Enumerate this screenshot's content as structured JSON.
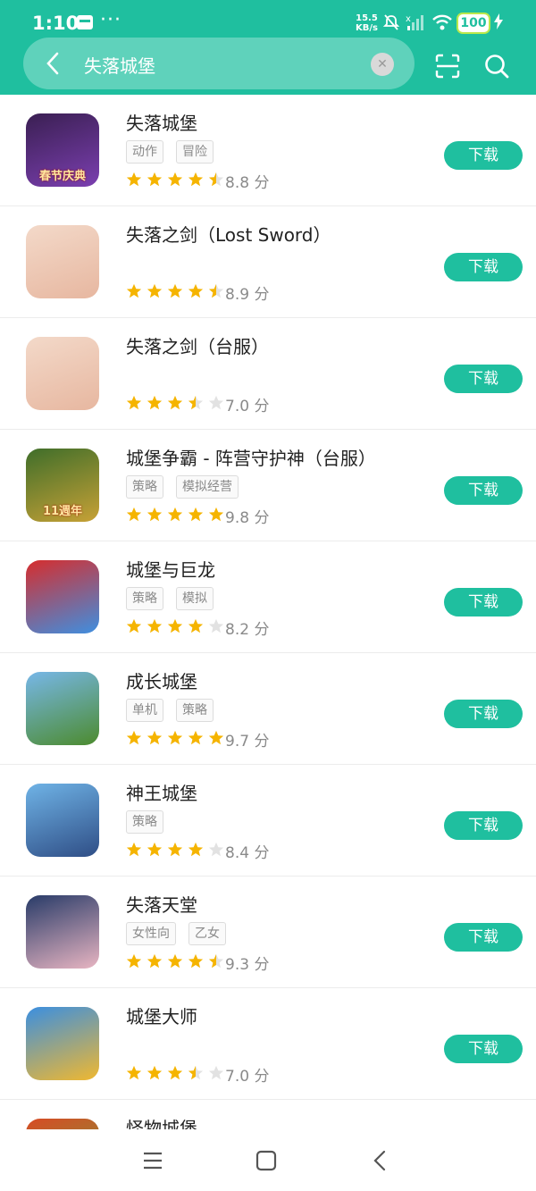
{
  "status": {
    "time": "1:10",
    "dots": "···",
    "net_speed_value": "15.5",
    "net_speed_unit": "KB/s",
    "battery": "100"
  },
  "search": {
    "query": "失落城堡"
  },
  "download_label": "下载",
  "apps": [
    {
      "name": "失落城堡",
      "tags": [
        "动作",
        "冒险"
      ],
      "rating": 4.5,
      "score": "8.8 分",
      "icon": "app-icon-lost-castle",
      "icon_text": "春节庆典",
      "colors": [
        "#3a1f52",
        "#7b3fb0"
      ]
    },
    {
      "name": "失落之剑（Lost Sword）",
      "tags": [],
      "rating": 4.5,
      "score": "8.9 分",
      "icon": "app-icon-lost-sword",
      "icon_text": "",
      "colors": [
        "#f3d9c9",
        "#e7b7a0"
      ]
    },
    {
      "name": "失落之剑（台服）",
      "tags": [],
      "rating": 3.5,
      "score": "7.0 分",
      "icon": "app-icon-lost-sword-tw",
      "icon_text": "",
      "colors": [
        "#f3d9c9",
        "#e7b7a0"
      ]
    },
    {
      "name": "城堡争霸 - 阵营守护神（台服）",
      "tags": [
        "策略",
        "模拟经营"
      ],
      "rating": 5,
      "score": "9.8 分",
      "icon": "app-icon-castle-clash",
      "icon_text": "11週年",
      "colors": [
        "#3f6e2a",
        "#c7a136"
      ]
    },
    {
      "name": "城堡与巨龙",
      "tags": [
        "策略",
        "模拟"
      ],
      "rating": 4,
      "score": "8.2 分",
      "icon": "app-icon-castles-dragons",
      "icon_text": "",
      "colors": [
        "#d62d2d",
        "#3f8fe0"
      ]
    },
    {
      "name": "成长城堡",
      "tags": [
        "单机",
        "策略"
      ],
      "rating": 5,
      "score": "9.7 分",
      "icon": "app-icon-grow-castle",
      "icon_text": "",
      "colors": [
        "#77b7e8",
        "#4c8b2e"
      ]
    },
    {
      "name": "神王城堡",
      "tags": [
        "策略"
      ],
      "rating": 4,
      "score": "8.4 分",
      "icon": "app-icon-god-king-castle",
      "icon_text": "",
      "colors": [
        "#6fb3e6",
        "#2f4e86"
      ]
    },
    {
      "name": "失落天堂",
      "tags": [
        "女性向",
        "乙女"
      ],
      "rating": 4.5,
      "score": "9.3 分",
      "icon": "app-icon-lost-paradise",
      "icon_text": "",
      "colors": [
        "#283b68",
        "#e8b5c2"
      ]
    },
    {
      "name": "城堡大师",
      "tags": [],
      "rating": 3.5,
      "score": "7.0 分",
      "icon": "app-icon-castle-master",
      "icon_text": "",
      "colors": [
        "#3b8fe0",
        "#f0b830"
      ]
    },
    {
      "name": "怪物城堡",
      "tags": [],
      "rating": 0,
      "score": "",
      "icon": "app-icon-monster-castle",
      "icon_text": "",
      "colors": [
        "#d84a24",
        "#6aa93c"
      ]
    }
  ]
}
